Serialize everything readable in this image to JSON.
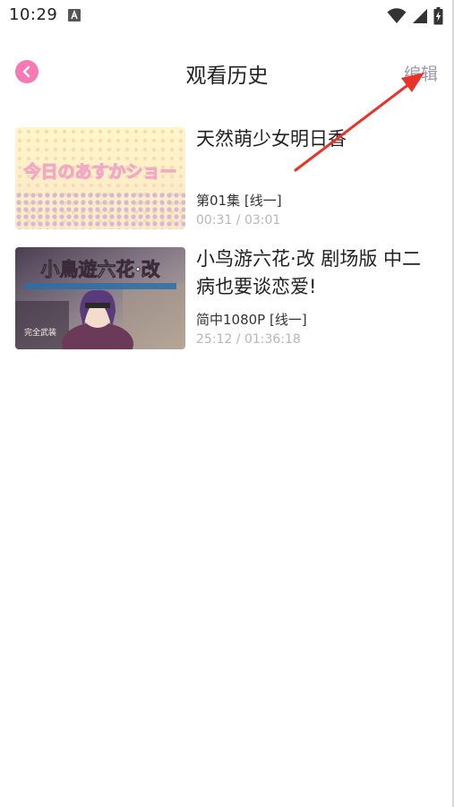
{
  "status_bar": {
    "time": "10:29"
  },
  "header": {
    "title": "观看历史",
    "edit_label": "编辑"
  },
  "history": [
    {
      "title": "天然萌少女明日香",
      "episode": "第01集 [线一]",
      "progress": "00:31 / 03:01",
      "watched_fraction": 0.17
    },
    {
      "title": "小鸟游六花·改 剧场版 中二病也要谈恋爱!",
      "episode": "简中1080P [线一]",
      "progress": "25:12 / 01:36:18",
      "watched_fraction": 0.26
    }
  ],
  "thumbnails": [
    {
      "logo": "今日のあすかショー"
    },
    {
      "logo": "小鳥遊六花·改",
      "badge": "完全武装"
    }
  ],
  "colors": {
    "accent_pink": "#f57ab4",
    "edit_gray": "#9a9aa8",
    "progress_gray": "#b6b6bd",
    "annotation_red": "#e8322a"
  },
  "icons": {
    "back": "chevron-left-icon",
    "wifi": "wifi-icon",
    "signal": "signal-icon",
    "battery": "battery-icon"
  }
}
